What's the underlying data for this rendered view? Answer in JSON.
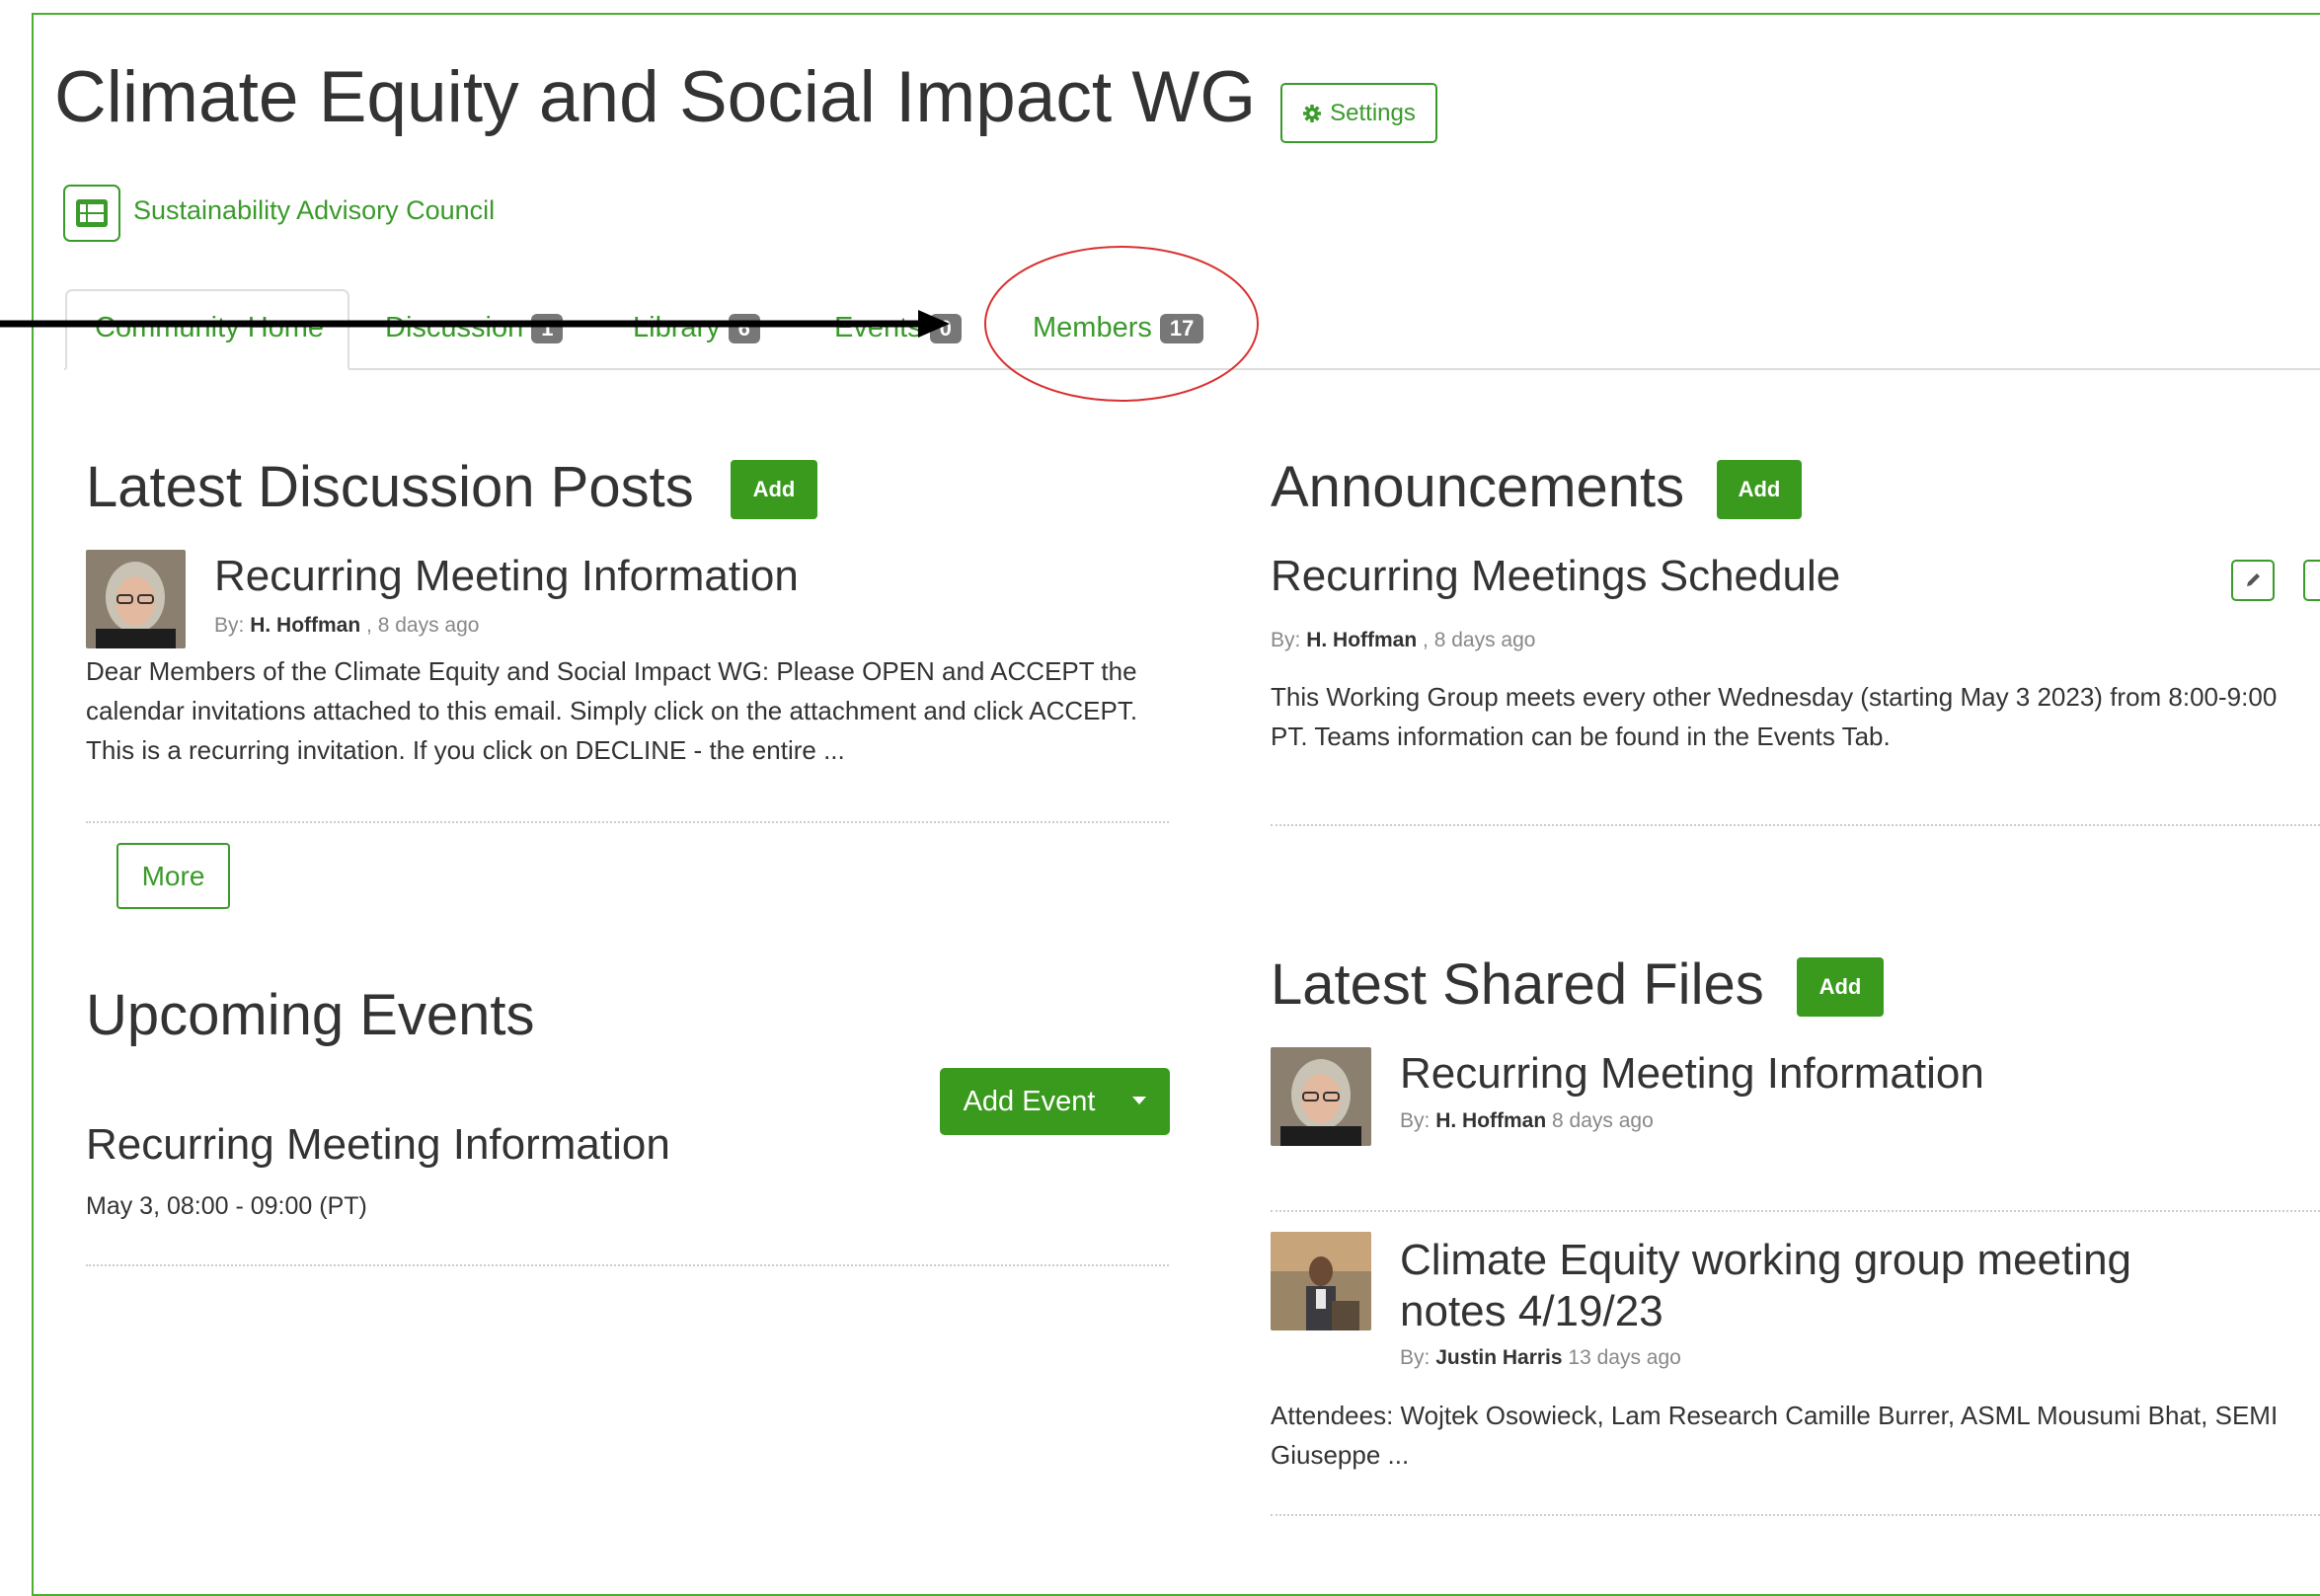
{
  "community": {
    "title": "Climate Equity and Social Impact WG",
    "settings_label": "Settings",
    "parent_label": "Sustainability Advisory Council"
  },
  "tabs": [
    {
      "label": "Community Home",
      "count": null,
      "active": true
    },
    {
      "label": "Discussion",
      "count": "1"
    },
    {
      "label": "Library",
      "count": "6"
    },
    {
      "label": "Events",
      "count": "0"
    },
    {
      "label": "Members",
      "count": "17"
    }
  ],
  "discussion": {
    "heading": "Latest Discussion Posts",
    "add_label": "Add",
    "post": {
      "title": "Recurring Meeting Information",
      "by_prefix": "By:",
      "author": "H. Hoffman",
      "age": ", 8 days ago",
      "excerpt": "Dear Members of the Climate Equity and Social Impact WG: Please OPEN and ACCEPT the calendar invitations attached to this email. Simply click on the attachment and click ACCEPT. This is a recurring invitation. If you click on DECLINE - the entire ..."
    },
    "more_label": "More"
  },
  "events": {
    "heading": "Upcoming Events",
    "add_event_label": "Add Event",
    "event": {
      "title": "Recurring Meeting Information",
      "when": "May 3, 08:00 - 09:00 (PT)"
    }
  },
  "announcements": {
    "heading": "Announcements",
    "add_label": "Add",
    "item": {
      "title": "Recurring Meetings Schedule",
      "by_prefix": "By:",
      "author": "H. Hoffman",
      "age": ", 8 days ago",
      "body": "This Working Group meets every other Wednesday (starting May 3 2023) from 8:00-9:00 PT.  Teams information can be found in the Events Tab."
    }
  },
  "files": {
    "heading": "Latest Shared Files",
    "add_label": "Add",
    "items": [
      {
        "title": "Recurring Meeting Information",
        "by_prefix": "By:",
        "author": "H. Hoffman",
        "age": "8 days ago"
      },
      {
        "title_line1": "Climate Equity working group meeting",
        "title_line2": "notes 4/19/23",
        "by_prefix": "By:",
        "author": "Justin Harris",
        "age": "13 days ago",
        "excerpt": "Attendees: Wojtek Osowieck, Lam Research Camille Burrer, ASML Mousumi Bhat, SEMI Giuseppe ..."
      }
    ]
  },
  "colors": {
    "accent": "#3a9a2a",
    "annotation_circle": "#d9302f",
    "arrow": "#000000"
  }
}
